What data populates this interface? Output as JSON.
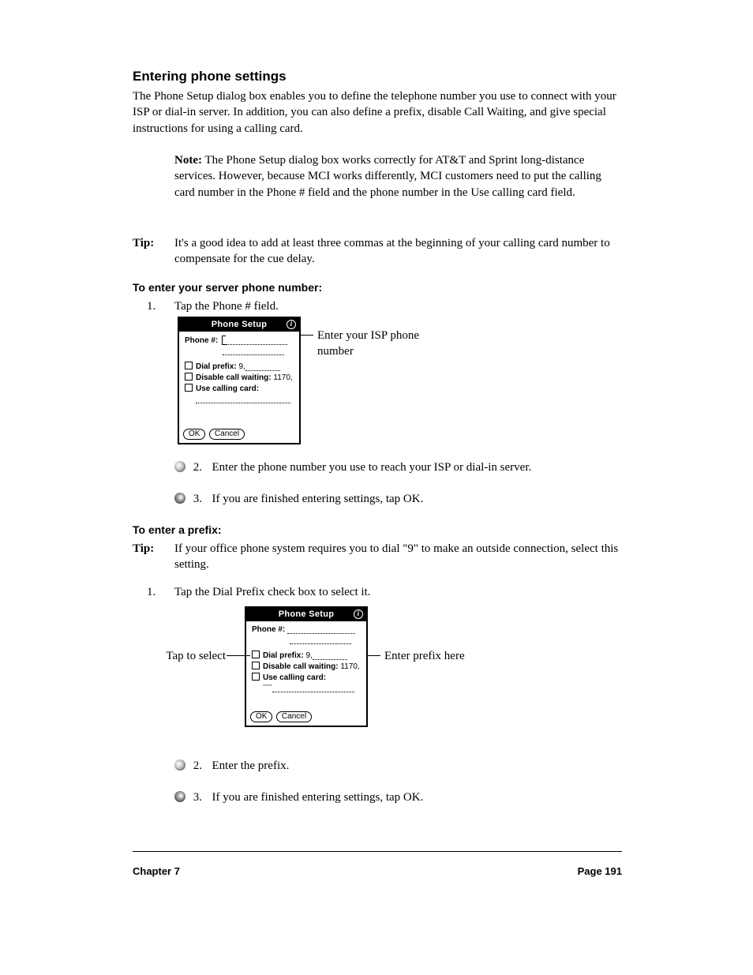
{
  "section_title": "Entering phone settings",
  "p1": "The Phone Setup dialog box enables you to define the telephone number you use to connect with your ISP or dial-in server. In addition, you can also define a prefix, disable Call Waiting, and give special instructions for using a calling card.",
  "note_label": "Note:",
  "note_text": "The Phone Setup dialog box works correctly for AT&T and Sprint long-distance services. However, because MCI works differently, MCI customers need to put the calling card number in the Phone # field and the phone number in the Use calling card field.",
  "step1": "To enter your server phone number:",
  "step1_1": "Tap the Phone # field.",
  "step1_2": "Enter the phone number you use to reach your ISP or dial-in server.",
  "step1_3": "If you are finished entering settings, tap OK.",
  "callout_phone": "Enter your ISP phone number",
  "step2": "To enter a prefix:",
  "step2_1": "Tap the Dial Prefix check box to select it.",
  "step2_2": "Enter the prefix.",
  "step2_3": "If you are finished entering settings, tap OK.",
  "callout_prefix_l": "Tap to select",
  "callout_prefix_r": "Enter prefix here",
  "tip_label": "Tip:",
  "tip1": "It's a good idea to add at least three commas at the beginning of your calling card number to compensate for the cue delay.",
  "tip2": "If your office phone system requires you to dial \"9\" to make an outside connection, select this setting.",
  "dialog": {
    "title": "Phone Setup",
    "phone_label": "Phone #:",
    "prefix_label": "Dial prefix:",
    "prefix_value": "9,",
    "cw_label": "Disable call waiting:",
    "cw_value": "1170,",
    "cc_label": "Use calling card:",
    "ok": "OK",
    "cancel": "Cancel"
  },
  "footer_left": "Chapter 7",
  "footer_right": "Page 191"
}
